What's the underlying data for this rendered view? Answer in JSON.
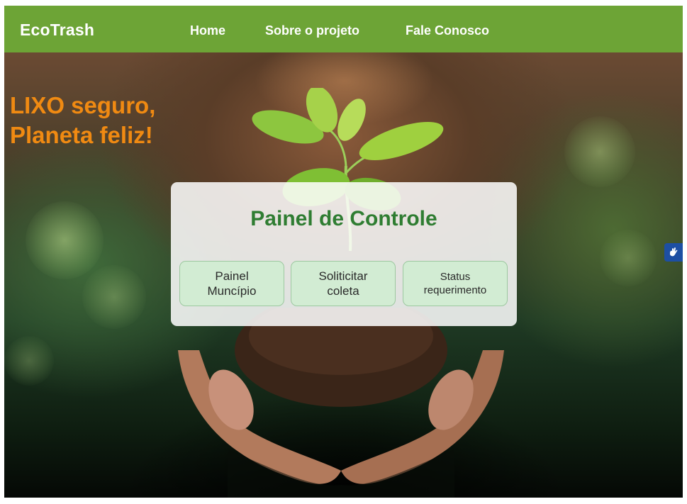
{
  "navbar": {
    "brand": "EcoTrash",
    "links": [
      "Home",
      "Sobre o projeto",
      "Fale Conosco"
    ],
    "background_color": "#6da436"
  },
  "hero": {
    "slogan_line1": "LIXO seguro,",
    "slogan_line2": "Planeta feliz!",
    "slogan_color": "#f08a12"
  },
  "panel": {
    "title": "Painel de Controle",
    "buttons": [
      {
        "line1": "Painel",
        "line2": "Muncípio"
      },
      {
        "line1": "Soliticitar",
        "line2": "coleta"
      },
      {
        "line1": "Status",
        "line2": "requerimento"
      }
    ]
  },
  "accessibility": {
    "icon": "hand-sign-language-icon"
  }
}
